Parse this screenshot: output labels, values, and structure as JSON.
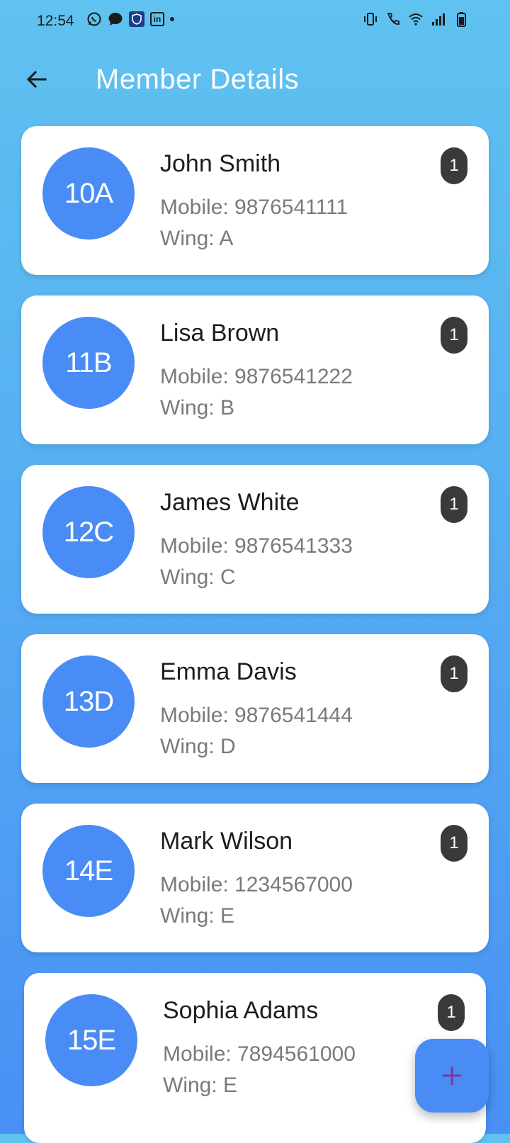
{
  "status_bar": {
    "time": "12:54",
    "left_icons": [
      "whatsapp-icon",
      "chat-icon",
      "shield-icon",
      "linkedin-icon",
      "dot-icon"
    ],
    "right_icons": [
      "vibrate-icon",
      "wifi-call-icon",
      "wifi-icon",
      "signal-icon",
      "battery-icon"
    ],
    "linkedin_text": "in"
  },
  "header": {
    "title": "Member Details",
    "back_icon": "back-arrow-icon"
  },
  "colors": {
    "avatar": "#4a8cf5",
    "badge": "#3a3a3a",
    "fab": "#4a8cf5",
    "fab_plus": "#7b3a92"
  },
  "members": [
    {
      "unit": "10A",
      "name": "John Smith",
      "mobile": "Mobile: 9876541111",
      "wing": "Wing: A",
      "count": "1"
    },
    {
      "unit": "11B",
      "name": "Lisa Brown",
      "mobile": "Mobile: 9876541222",
      "wing": "Wing: B",
      "count": "1"
    },
    {
      "unit": "12C",
      "name": "James White",
      "mobile": "Mobile: 9876541333",
      "wing": "Wing: C",
      "count": "1"
    },
    {
      "unit": "13D",
      "name": "Emma Davis",
      "mobile": "Mobile: 9876541444",
      "wing": "Wing: D",
      "count": "1"
    },
    {
      "unit": "14E",
      "name": "Mark Wilson",
      "mobile": "Mobile: 1234567000",
      "wing": "Wing: E",
      "count": "1"
    },
    {
      "unit": "15E",
      "name": "Sophia Adams",
      "mobile": "Mobile: 7894561000",
      "wing": "Wing: E",
      "count": "1"
    }
  ],
  "fab": {
    "icon": "plus-icon"
  }
}
